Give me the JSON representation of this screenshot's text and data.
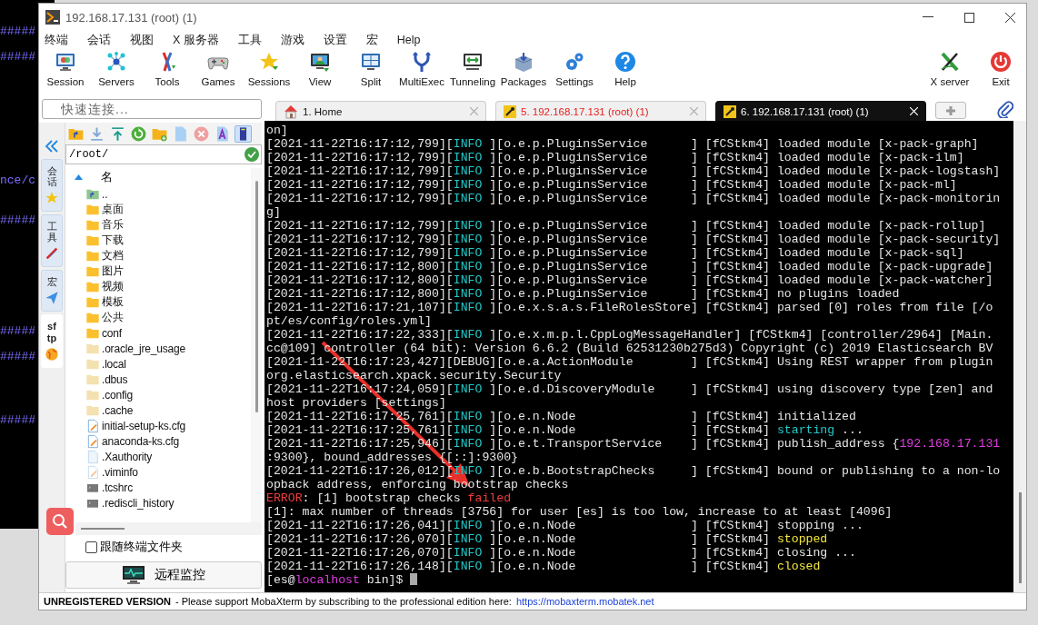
{
  "background_terminal": [
    "#####",
    "#####",
    "nce/c",
    "#####",
    "#####",
    "#####",
    "#####"
  ],
  "window": {
    "title": "192.168.17.131 (root) (1)"
  },
  "menu": [
    "终端",
    "会话",
    "视图",
    "X 服务器",
    "工具",
    "游戏",
    "设置",
    "宏",
    "Help"
  ],
  "toolbar": [
    "Session",
    "Servers",
    "Tools",
    "Games",
    "Sessions",
    "View",
    "Split",
    "MultiExec",
    "Tunneling",
    "Packages",
    "Settings",
    "Help"
  ],
  "toolbar_right": [
    "X server",
    "Exit"
  ],
  "quick_connect": {
    "placeholder": "快速连接..."
  },
  "tabs": [
    {
      "label": "1. Home",
      "selected": false,
      "disconnected": false
    },
    {
      "label": "5. 192.168.17.131 (root) (1)",
      "selected": false,
      "disconnected": true
    },
    {
      "label": "6. 192.168.17.131 (root) (1)",
      "selected": true,
      "disconnected": false
    }
  ],
  "side_tabs": [
    {
      "label": "会话",
      "selected": false
    },
    {
      "label": "工具",
      "selected": false
    },
    {
      "label": "宏",
      "selected": false
    },
    {
      "label": "sftp",
      "selected": true
    }
  ],
  "sftp": {
    "path": "/root/",
    "column": "名",
    "items": [
      {
        "name": "..",
        "kind": "parent"
      },
      {
        "name": "桌面",
        "kind": "folder"
      },
      {
        "name": "音乐",
        "kind": "folder"
      },
      {
        "name": "下载",
        "kind": "folder"
      },
      {
        "name": "文档",
        "kind": "folder"
      },
      {
        "name": "图片",
        "kind": "folder"
      },
      {
        "name": "视频",
        "kind": "folder"
      },
      {
        "name": "模板",
        "kind": "folder"
      },
      {
        "name": "公共",
        "kind": "folder"
      },
      {
        "name": "conf",
        "kind": "folder"
      },
      {
        "name": ".oracle_jre_usage",
        "kind": "hidden_folder"
      },
      {
        "name": ".local",
        "kind": "hidden_folder"
      },
      {
        "name": ".dbus",
        "kind": "hidden_folder"
      },
      {
        "name": ".config",
        "kind": "hidden_folder"
      },
      {
        "name": ".cache",
        "kind": "hidden_folder"
      },
      {
        "name": "initial-setup-ks.cfg",
        "kind": "config"
      },
      {
        "name": "anaconda-ks.cfg",
        "kind": "config"
      },
      {
        "name": ".Xauthority",
        "kind": "file"
      },
      {
        "name": ".viminfo",
        "kind": "text"
      },
      {
        "name": ".tcshrc",
        "kind": "terminal"
      },
      {
        "name": ".rediscli_history",
        "kind": "terminal"
      }
    ],
    "follow_terminal": {
      "label": "跟随终端文件夹",
      "checked": false
    },
    "monitor_button": "远程监控"
  },
  "terminal": {
    "cursor": true,
    "lines": [
      [
        {
          "text": "on]",
          "kind": "plain"
        }
      ],
      [
        {
          "text": "[2021-11-22T16:17:12,799][",
          "kind": "plain"
        },
        {
          "text": "INFO",
          "kind": "info"
        },
        {
          "text": " ][o.e.p.PluginsService      ] [fCStkm4] loaded module [x-pack-graph]",
          "kind": "plain"
        }
      ],
      [
        {
          "text": "[2021-11-22T16:17:12,799][",
          "kind": "plain"
        },
        {
          "text": "INFO",
          "kind": "info"
        },
        {
          "text": " ][o.e.p.PluginsService      ] [fCStkm4] loaded module [x-pack-ilm]",
          "kind": "plain"
        }
      ],
      [
        {
          "text": "[2021-11-22T16:17:12,799][",
          "kind": "plain"
        },
        {
          "text": "INFO",
          "kind": "info"
        },
        {
          "text": " ][o.e.p.PluginsService      ] [fCStkm4] loaded module [x-pack-logstash]",
          "kind": "plain"
        }
      ],
      [
        {
          "text": "[2021-11-22T16:17:12,799][",
          "kind": "plain"
        },
        {
          "text": "INFO",
          "kind": "info"
        },
        {
          "text": " ][o.e.p.PluginsService      ] [fCStkm4] loaded module [x-pack-ml]",
          "kind": "plain"
        }
      ],
      [
        {
          "text": "[2021-11-22T16:17:12,799][",
          "kind": "plain"
        },
        {
          "text": "INFO",
          "kind": "info"
        },
        {
          "text": " ][o.e.p.PluginsService      ] [fCStkm4] loaded module [x-pack-monitorin",
          "kind": "plain"
        }
      ],
      [
        {
          "text": "g]",
          "kind": "plain"
        }
      ],
      [
        {
          "text": "[2021-11-22T16:17:12,799][",
          "kind": "plain"
        },
        {
          "text": "INFO",
          "kind": "info"
        },
        {
          "text": " ][o.e.p.PluginsService      ] [fCStkm4] loaded module [x-pack-rollup]",
          "kind": "plain"
        }
      ],
      [
        {
          "text": "[2021-11-22T16:17:12,799][",
          "kind": "plain"
        },
        {
          "text": "INFO",
          "kind": "info"
        },
        {
          "text": " ][o.e.p.PluginsService      ] [fCStkm4] loaded module [x-pack-security]",
          "kind": "plain"
        }
      ],
      [
        {
          "text": "[2021-11-22T16:17:12,799][",
          "kind": "plain"
        },
        {
          "text": "INFO",
          "kind": "info"
        },
        {
          "text": " ][o.e.p.PluginsService      ] [fCStkm4] loaded module [x-pack-sql]",
          "kind": "plain"
        }
      ],
      [
        {
          "text": "[2021-11-22T16:17:12,800][",
          "kind": "plain"
        },
        {
          "text": "INFO",
          "kind": "info"
        },
        {
          "text": " ][o.e.p.PluginsService      ] [fCStkm4] loaded module [x-pack-upgrade]",
          "kind": "plain"
        }
      ],
      [
        {
          "text": "[2021-11-22T16:17:12,800][",
          "kind": "plain"
        },
        {
          "text": "INFO",
          "kind": "info"
        },
        {
          "text": " ][o.e.p.PluginsService      ] [fCStkm4] loaded module [x-pack-watcher]",
          "kind": "plain"
        }
      ],
      [
        {
          "text": "[2021-11-22T16:17:12,800][",
          "kind": "plain"
        },
        {
          "text": "INFO",
          "kind": "info"
        },
        {
          "text": " ][o.e.p.PluginsService      ] [fCStkm4] no plugins loaded",
          "kind": "plain"
        }
      ],
      [
        {
          "text": "[2021-11-22T16:17:21,107][",
          "kind": "plain"
        },
        {
          "text": "INFO",
          "kind": "info"
        },
        {
          "text": " ][o.e.x.s.a.s.FileRolesStore] [fCStkm4] parsed [0] roles from file [/o",
          "kind": "plain"
        }
      ],
      [
        {
          "text": "pt/es/config/roles.yml]",
          "kind": "plain"
        }
      ],
      [
        {
          "text": "[2021-11-22T16:17:22,333][",
          "kind": "plain"
        },
        {
          "text": "INFO",
          "kind": "info"
        },
        {
          "text": " ][o.e.x.m.p.l.CppLogMessageHandler] [fCStkm4] [controller/2964] [Main.",
          "kind": "plain"
        }
      ],
      [
        {
          "text": "cc@109] controller (64 bit): Version 6.6.2 (Build 62531230b275d3) Copyright (c) 2019 Elasticsearch BV",
          "kind": "plain"
        }
      ],
      [
        {
          "text": "[2021-11-22T16:17:23,427][DEBUG][o.e.a.ActionModule        ] [fCStkm4] Using REST wrapper from plugin",
          "kind": "plain"
        }
      ],
      [
        {
          "text": "org.elasticsearch.xpack.security.Security",
          "kind": "plain"
        }
      ],
      [
        {
          "text": "[2021-11-22T16:17:24,059][",
          "kind": "plain"
        },
        {
          "text": "INFO",
          "kind": "info"
        },
        {
          "text": " ][o.e.d.DiscoveryModule     ] [fCStkm4] using discovery type [zen] and",
          "kind": "plain"
        }
      ],
      [
        {
          "text": "host providers [settings]",
          "kind": "plain"
        }
      ],
      [
        {
          "text": "[2021-11-22T16:17:25,761][",
          "kind": "plain"
        },
        {
          "text": "INFO",
          "kind": "info"
        },
        {
          "text": " ][o.e.n.Node                ] [fCStkm4] initialized",
          "kind": "plain"
        }
      ],
      [
        {
          "text": "[2021-11-22T16:17:25,761][",
          "kind": "plain"
        },
        {
          "text": "INFO",
          "kind": "info"
        },
        {
          "text": " ][o.e.n.Node                ] [fCStkm4] ",
          "kind": "plain"
        },
        {
          "text": "starting",
          "kind": "info"
        },
        {
          "text": " ...",
          "kind": "plain"
        }
      ],
      [
        {
          "text": "[2021-11-22T16:17:25,946][",
          "kind": "plain"
        },
        {
          "text": "INFO",
          "kind": "info"
        },
        {
          "text": " ][o.e.t.TransportService    ] [fCStkm4] publish_address {",
          "kind": "plain"
        },
        {
          "text": "192.168.17.131",
          "kind": "magenta"
        }
      ],
      [
        {
          "text": ":9300}, bound_addresses {[::]:9300}",
          "kind": "plain"
        }
      ],
      [
        {
          "text": "[2021-11-22T16:17:26,012][",
          "kind": "plain"
        },
        {
          "text": "INFO",
          "kind": "info"
        },
        {
          "text": " ][o.e.b.BootstrapChecks     ] [fCStkm4] bound or publishing to a non-lo",
          "kind": "plain"
        }
      ],
      [
        {
          "text": "opback address, enforcing bootstrap checks",
          "kind": "plain"
        }
      ],
      [
        {
          "text": "ERROR",
          "kind": "error"
        },
        {
          "text": ": [1] bootstrap checks ",
          "kind": "plain"
        },
        {
          "text": "failed",
          "kind": "error"
        }
      ],
      [
        {
          "text": "[1]: max number of threads [3756] for user [es] is too low, increase to at least [4096]",
          "kind": "plain"
        }
      ],
      [
        {
          "text": "[2021-11-22T16:17:26,041][",
          "kind": "plain"
        },
        {
          "text": "INFO",
          "kind": "info"
        },
        {
          "text": " ][o.e.n.Node                ] [fCStkm4] stopping ...",
          "kind": "plain"
        }
      ],
      [
        {
          "text": "[2021-11-22T16:17:26,070][",
          "kind": "plain"
        },
        {
          "text": "INFO",
          "kind": "info"
        },
        {
          "text": " ][o.e.n.Node                ] [fCStkm4] ",
          "kind": "plain"
        },
        {
          "text": "stopped",
          "kind": "yellow"
        }
      ],
      [
        {
          "text": "[2021-11-22T16:17:26,070][",
          "kind": "plain"
        },
        {
          "text": "INFO",
          "kind": "info"
        },
        {
          "text": " ][o.e.n.Node                ] [fCStkm4] closing ...",
          "kind": "plain"
        }
      ],
      [
        {
          "text": "[2021-11-22T16:17:26,148][",
          "kind": "plain"
        },
        {
          "text": "INFO",
          "kind": "info"
        },
        {
          "text": " ][o.e.n.Node                ] [fCStkm4] ",
          "kind": "plain"
        },
        {
          "text": "closed",
          "kind": "yellow"
        }
      ],
      [
        {
          "text": "[es@",
          "kind": "plain"
        },
        {
          "text": "localhost",
          "kind": "magenta"
        },
        {
          "text": " bin]$ ",
          "kind": "plain"
        }
      ]
    ]
  },
  "status_bar": {
    "label": "UNREGISTERED VERSION",
    "message": "-  Please support MobaXterm by subscribing to the professional edition here:",
    "link": "https://mobaxterm.mobatek.net"
  }
}
